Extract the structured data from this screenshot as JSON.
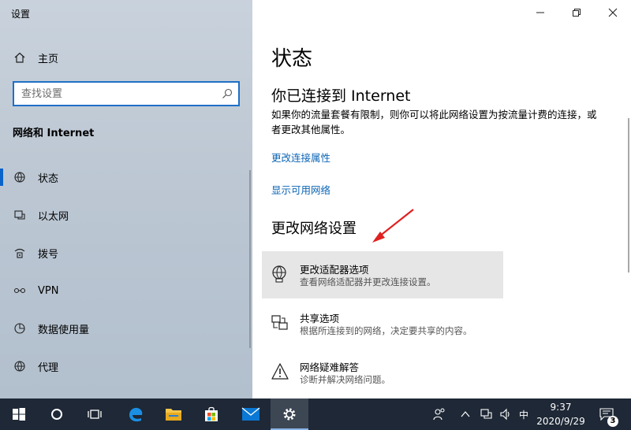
{
  "window": {
    "title": "设置"
  },
  "sidebar": {
    "home_label": "主页",
    "search_placeholder": "查找设置",
    "section_heading": "网络和 Internet",
    "items": [
      {
        "label": "状态",
        "icon": "status-icon"
      },
      {
        "label": "以太网",
        "icon": "ethernet-icon"
      },
      {
        "label": "拨号",
        "icon": "dialup-icon"
      },
      {
        "label": "VPN",
        "icon": "vpn-icon"
      },
      {
        "label": "数据使用量",
        "icon": "data-usage-icon"
      },
      {
        "label": "代理",
        "icon": "proxy-icon"
      }
    ],
    "active_item": "状态"
  },
  "main": {
    "title": "状态",
    "connection_heading": "你已连接到 Internet",
    "connection_desc": "如果你的流量套餐有限制，则你可以将此网络设置为按流量计费的连接，或者更改其他属性。",
    "links": [
      "更改连接属性",
      "显示可用网络"
    ],
    "change_heading": "更改网络设置",
    "options": [
      {
        "title": "更改适配器选项",
        "desc": "查看网络适配器并更改连接设置。",
        "icon": "adapter-globe-icon",
        "highlighted": true
      },
      {
        "title": "共享选项",
        "desc": "根据所连接到的网络，决定要共享的内容。",
        "icon": "sharing-icon",
        "highlighted": false
      },
      {
        "title": "网络疑难解答",
        "desc": "诊断并解决网络问题。",
        "icon": "warning-icon",
        "highlighted": false
      }
    ]
  },
  "taskbar": {
    "ime": "中",
    "time": "9:37",
    "date": "2020/9/29",
    "notification_count": "3",
    "apps": [
      "start-icon",
      "cortana-icon",
      "task-view-icon",
      "edge-icon",
      "file-explorer-icon",
      "store-icon",
      "mail-icon",
      "settings-icon"
    ]
  },
  "colors": {
    "accent": "#0a63c9",
    "link": "#0a64b5",
    "taskbar": "#1e2836",
    "arrow": "#e02020"
  }
}
